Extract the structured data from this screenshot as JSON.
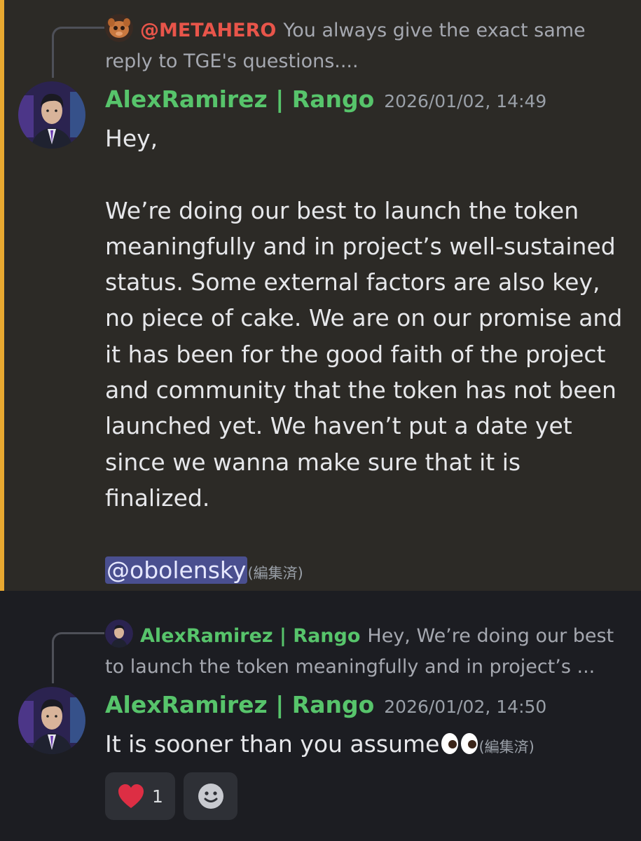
{
  "message1": {
    "reply": {
      "author": "@METAHERO",
      "author_color": "#e8554a",
      "snippet_line1": "You always give the exact same",
      "snippet_line2": "reply to TGE's questions...."
    },
    "author": "AlexRamirez | Rango",
    "timestamp": "2026/01/02, 14:49",
    "greeting": "Hey,",
    "lines": [
      "We’re doing our best to launch the token",
      "meaningfully and in project’s well-sustained",
      "status. Some external factors are also key,",
      "no piece of cake. We are on our promise and",
      "it has been for the good faith of the project",
      "and community that the token has not been",
      "launched yet. We haven’t put a date yet",
      "since we wanna make sure that it is",
      "finalized."
    ],
    "mention": "@obolensky",
    "edited": "(編集済)",
    "accent_color": "#e8a830"
  },
  "message2": {
    "reply": {
      "author": "AlexRamirez | Rango",
      "author_color": "#57c46b",
      "snippet_line1": "Hey,  We’re doing our best",
      "snippet_line2": "to launch the token meaningfully and in project’s ..."
    },
    "author": "AlexRamirez | Rango",
    "timestamp": "2026/01/02, 14:50",
    "text": "It is sooner than you assume",
    "edited": "(編集済)"
  },
  "reactions": [
    {
      "icon": "heart-icon",
      "count": "1"
    },
    {
      "icon": "add-reaction-icon",
      "count": ""
    }
  ]
}
